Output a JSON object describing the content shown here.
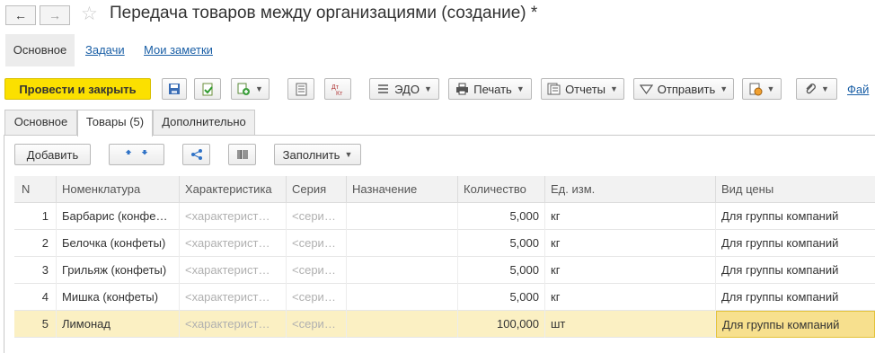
{
  "window": {
    "title": "Передача товаров между организациями (создание) *"
  },
  "section_tabs": [
    "Основное",
    "Задачи",
    "Мои заметки"
  ],
  "commands": {
    "post_close": "Провести и закрыть",
    "edo": "ЭДО",
    "print": "Печать",
    "reports": "Отчеты",
    "send": "Отправить",
    "files_link": "Фай"
  },
  "form_tabs": [
    "Основное",
    "Товары (5)",
    "Дополнительно"
  ],
  "table_toolbar": {
    "add": "Добавить",
    "fill": "Заполнить"
  },
  "table": {
    "columns": [
      "N",
      "Номенклатура",
      "Характеристика",
      "Серия",
      "Назначение",
      "Количество",
      "Ед. изм.",
      "Вид цены"
    ],
    "rows": [
      {
        "n": "1",
        "item": "Барбарис (конфе…",
        "char": "<характерист…",
        "series": "<сери…",
        "purpose": "",
        "qty": "5,000",
        "unit": "кг",
        "price_type": "Для группы компаний"
      },
      {
        "n": "2",
        "item": "Белочка (конфеты)",
        "char": "<характерист…",
        "series": "<сери…",
        "purpose": "",
        "qty": "5,000",
        "unit": "кг",
        "price_type": "Для группы компаний"
      },
      {
        "n": "3",
        "item": "Грильяж (конфеты)",
        "char": "<характерист…",
        "series": "<сери…",
        "purpose": "",
        "qty": "5,000",
        "unit": "кг",
        "price_type": "Для группы компаний"
      },
      {
        "n": "4",
        "item": "Мишка (конфеты)",
        "char": "<характерист…",
        "series": "<сери…",
        "purpose": "",
        "qty": "5,000",
        "unit": "кг",
        "price_type": "Для группы компаний"
      },
      {
        "n": "5",
        "item": "Лимонад",
        "char": "<характерист…",
        "series": "<сери…",
        "purpose": "",
        "qty": "100,000",
        "unit": "шт",
        "price_type": "Для группы компаний"
      }
    ],
    "selected_row": 5
  },
  "colors": {
    "primary_button": "#fbe000",
    "link": "#1a5fa6",
    "selected_row": "#fbf0c3"
  }
}
